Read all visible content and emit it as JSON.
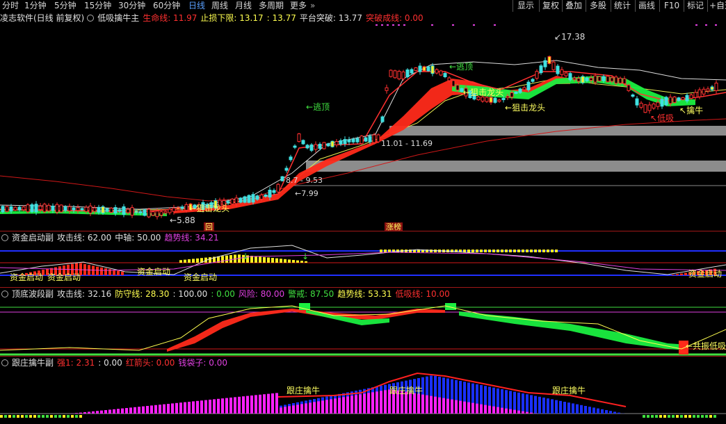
{
  "toolbar": {
    "timeframes": [
      "分时",
      "1分钟",
      "5分钟",
      "15分钟",
      "30分钟",
      "60分钟",
      "日线",
      "周线",
      "月线",
      "多周期",
      "更多"
    ],
    "active": "日线",
    "right_buttons": [
      "显示",
      "复权",
      "叠加",
      "多股",
      "统计",
      "画线",
      "F10",
      "标记",
      "+自选"
    ]
  },
  "main": {
    "title": "凌志软件(日线 前复权)",
    "indicator": "低吸擒牛主",
    "lines": [
      {
        "label": "生命线: 11.97",
        "color": "#ff3030"
      },
      {
        "label": "止损下限: 13.17",
        "color": "#ffff50"
      },
      {
        "label": ": 13.77",
        "color": "#ffff50"
      },
      {
        "label": "平台突破: 13.77",
        "color": "#e0e0e0"
      },
      {
        "label": "突破成线: 0.00",
        "color": "#ff3030"
      }
    ],
    "annotations": {
      "high": "17.38",
      "low": "5.88",
      "runaway1": "逃顶",
      "runaway2": "逃顶",
      "snipe1": "狙击龙头",
      "snipe2": "狙击龙头",
      "snipe3": "狙击龙头",
      "catch": "擒牛",
      "lowbuy": "低吸",
      "range1": "11.01 - 11.69",
      "range2": "8.7 - 9.53",
      "price2": "7.99",
      "tag_hui": "回",
      "tag_zt": "涨榜"
    }
  },
  "pane1": {
    "title": "资金启动副",
    "lines": [
      {
        "label": "攻击线: 62.00",
        "color": "#e0e0e0"
      },
      {
        "label": "中轴: 50.00",
        "color": "#e0e0e0"
      },
      {
        "label": "趋势线: 34.21",
        "color": "#e040e0"
      }
    ],
    "labels": [
      "资金启动",
      "资金启动",
      "资金启动",
      "资金启动",
      "资金启动"
    ]
  },
  "pane2": {
    "title": "顶底波段副",
    "lines": [
      {
        "label": "攻击线: 32.16",
        "color": "#e0e0e0"
      },
      {
        "label": "防守线: 28.30",
        "color": "#ffff50"
      },
      {
        "label": ": 100.00",
        "color": "#e0e0e0"
      },
      {
        "label": ": 0.00",
        "color": "#40e040"
      },
      {
        "label": "风险: 80.00",
        "color": "#e040e0"
      },
      {
        "label": "警戒: 87.50",
        "color": "#40e040"
      },
      {
        "label": "趋势线: 53.31",
        "color": "#ffff50"
      },
      {
        "label": "低吸线: 10.00",
        "color": "#ff3030"
      }
    ],
    "labels": [
      "共振低吸"
    ]
  },
  "pane3": {
    "title": "跟庄擒牛副",
    "lines": [
      {
        "label": "强1: 2.31",
        "color": "#ff3030"
      },
      {
        "label": ": 0.00",
        "color": "#e0e0e0"
      },
      {
        "label": "红箭头: 0.00",
        "color": "#ff3030"
      },
      {
        "label": "钱袋子: 0.00",
        "color": "#e040e0"
      }
    ],
    "labels": [
      "跟庄擒牛",
      "跟庄擒牛",
      "跟庄擒牛"
    ]
  },
  "colors": {
    "up": "#ff3030",
    "down": "#40e0e0",
    "accent": "#ffff40",
    "bg": "#000000"
  }
}
